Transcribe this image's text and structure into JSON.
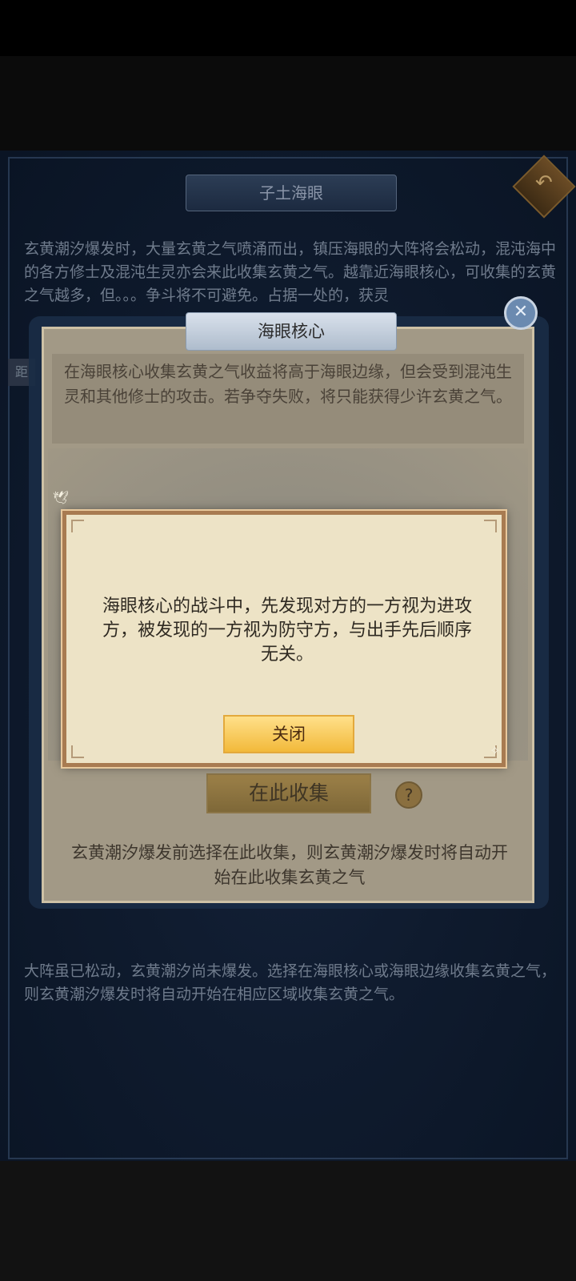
{
  "background": {
    "title": "子土海眼",
    "top_text": "玄黄潮汐爆发时，大量玄黄之气喷涌而出，镇压海眼的大阵将会松动，混沌海中的各方修士及混沌生灵亦会来此收集玄黄之气。越靠近海眼核心，可收集的玄黄之气越多，但。。。争斗将不可避免。占据一处的，获灵",
    "bottom_text": "大阵虽已松动，玄黄潮汐尚未爆发。选择在海眼核心或海眼边缘收集玄黄之气，则玄黄潮汐爆发时将自动开始在相应区域收集玄黄之气。",
    "side_tag": "距"
  },
  "core_panel": {
    "title": "海眼核心",
    "description": "在海眼核心收集玄黄之气收益将高于海眼边缘，但会受到混沌生灵和其他修士的攻击。若争夺失败，将只能获得少许玄黄之气。",
    "collect_button": "在此收集",
    "help_icon_text": "?",
    "note": "玄黄潮汐爆发前选择在此收集，则玄黄潮汐爆发时将自动开始在此收集玄黄之气"
  },
  "dialog": {
    "message": "海眼核心的战斗中，先发现对方的一方视为进攻方，被发现的一方视为防守方，与出手先后顺序无关。",
    "close_button": "关闭"
  },
  "icons": {
    "back": "back-arrow-icon",
    "close": "close-x-icon",
    "help": "help-icon"
  }
}
